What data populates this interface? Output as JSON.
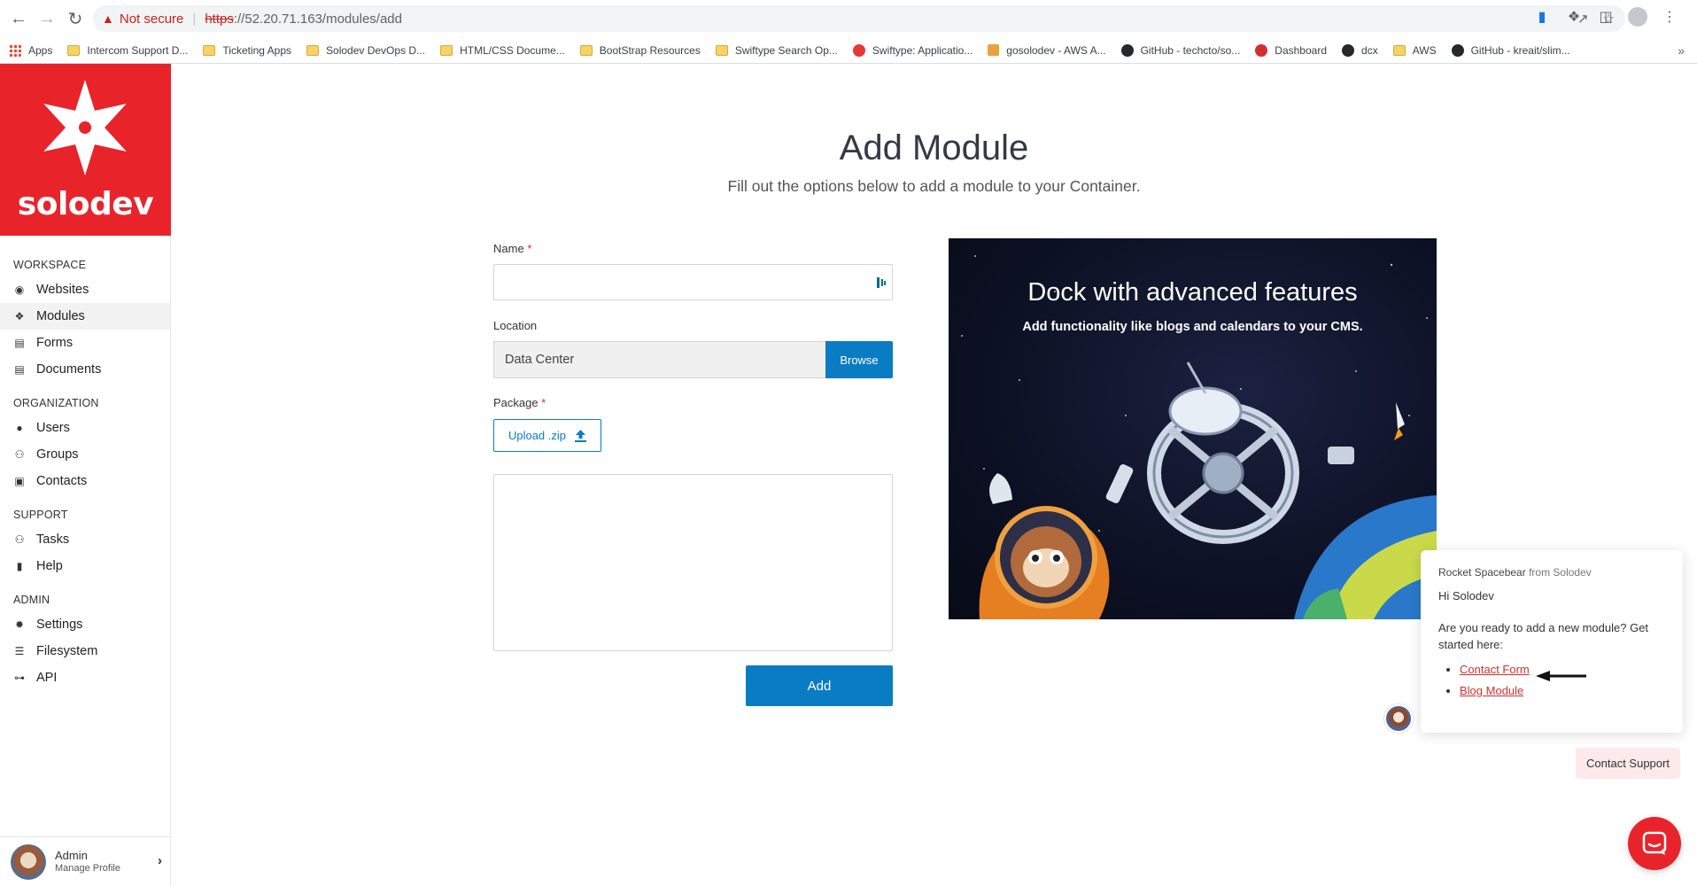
{
  "browser": {
    "not_secure": "Not secure",
    "url_scheme": "https",
    "url_rest": "://52.20.71.163/modules/add",
    "bookmarks": [
      {
        "label": "Apps",
        "icon": "apps"
      },
      {
        "label": "Intercom Support D...",
        "icon": "folder"
      },
      {
        "label": "Ticketing Apps",
        "icon": "folder"
      },
      {
        "label": "Solodev DevOps D...",
        "icon": "folder"
      },
      {
        "label": "HTML/CSS Docume...",
        "icon": "folder"
      },
      {
        "label": "BootStrap Resources",
        "icon": "folder"
      },
      {
        "label": "Swiftype Search Op...",
        "icon": "folder"
      },
      {
        "label": "Swiftype: Applicatio...",
        "icon": "red"
      },
      {
        "label": "gosolodev - AWS A...",
        "icon": "aws"
      },
      {
        "label": "GitHub - techcto/so...",
        "icon": "gh"
      },
      {
        "label": "Dashboard",
        "icon": "star"
      },
      {
        "label": "dcx",
        "icon": "gh"
      },
      {
        "label": "AWS",
        "icon": "folder"
      },
      {
        "label": "GitHub - kreait/slim...",
        "icon": "gh"
      }
    ],
    "more": "»"
  },
  "sidebar": {
    "logo_text": "solodev",
    "sections": [
      {
        "heading": "WORKSPACE",
        "items": [
          {
            "label": "Websites",
            "icon": "globe-icon",
            "glyph": "◉"
          },
          {
            "label": "Modules",
            "icon": "cubes-icon",
            "glyph": "❖",
            "active": true
          },
          {
            "label": "Forms",
            "icon": "form-icon",
            "glyph": "▤"
          },
          {
            "label": "Documents",
            "icon": "document-icon",
            "glyph": "▤"
          }
        ]
      },
      {
        "heading": "ORGANIZATION",
        "items": [
          {
            "label": "Users",
            "icon": "user-icon",
            "glyph": "●"
          },
          {
            "label": "Groups",
            "icon": "group-icon",
            "glyph": "⚇"
          },
          {
            "label": "Contacts",
            "icon": "contact-card-icon",
            "glyph": "▣"
          }
        ]
      },
      {
        "heading": "SUPPORT",
        "items": [
          {
            "label": "Tasks",
            "icon": "tasks-icon",
            "glyph": "⚇"
          },
          {
            "label": "Help",
            "icon": "help-doc-icon",
            "glyph": "▮"
          }
        ]
      },
      {
        "heading": "ADMIN",
        "items": [
          {
            "label": "Settings",
            "icon": "gear-icon",
            "glyph": "✹"
          },
          {
            "label": "Filesystem",
            "icon": "list-icon",
            "glyph": "☰"
          },
          {
            "label": "API",
            "icon": "api-icon",
            "glyph": "⊶"
          }
        ]
      }
    ],
    "profile": {
      "name": "Admin",
      "sub": "Manage Profile"
    }
  },
  "main": {
    "title": "Add Module",
    "subtitle": "Fill out the options below to add a module to your Container.",
    "form": {
      "name_label": "Name",
      "name_value": "",
      "required_mark": "*",
      "location_label": "Location",
      "location_value": "Data Center",
      "browse_label": "Browse",
      "package_label": "Package",
      "upload_label": "Upload .zip",
      "add_label": "Add"
    }
  },
  "promo": {
    "title": "Dock with advanced features",
    "subtitle": "Add functionality like blogs and calendars to your CMS."
  },
  "chat": {
    "sender_name": "Rocket Spacebear",
    "sender_from": "from Solodev",
    "greeting": "Hi Solodev",
    "body": "Are you ready to add a new module? Get started here:",
    "links": [
      "Contact Form",
      "Blog Module"
    ],
    "contact_support": "Contact Support"
  },
  "colors": {
    "brand_red": "#e8242a",
    "primary_blue": "#0a7cc4",
    "link_red": "#d32f2f"
  }
}
